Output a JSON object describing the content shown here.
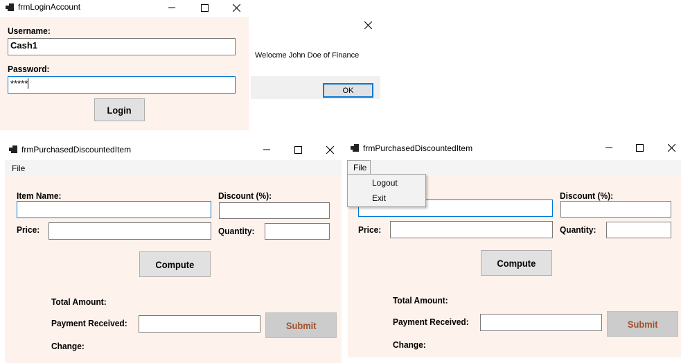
{
  "login": {
    "title": "frmLoginAccount",
    "username_label": "Username:",
    "username_value": "Cash1",
    "password_label": "Password:",
    "password_value": "*****",
    "login_button": "Login"
  },
  "msgbox": {
    "message": "Welocme John Doe of Finance",
    "ok_button": "OK"
  },
  "purchase_left": {
    "title": "frmPurchasedDiscountedItem",
    "menu_file": "File",
    "item_name_label": "Item Name:",
    "discount_label": "Discount (%):",
    "price_label": "Price:",
    "quantity_label": "Quantity:",
    "compute_button": "Compute",
    "total_amount_label": "Total Amount:",
    "payment_received_label": "Payment Received:",
    "submit_button": "Submit",
    "change_label": "Change:"
  },
  "purchase_right": {
    "title": "frmPurchasedDiscountedItem",
    "menu_file": "File",
    "menu_items": [
      "Logout",
      "Exit"
    ],
    "discount_label": "Discount (%):",
    "price_label": "Price:",
    "quantity_label": "Quantity:",
    "compute_button": "Compute",
    "total_amount_label": "Total Amount:",
    "payment_received_label": "Payment Received:",
    "submit_button": "Submit",
    "change_label": "Change:"
  },
  "colors": {
    "form_background": "#fdf2ec",
    "focus_border": "#0078d7",
    "disabled_button_text": "#a0522d"
  },
  "icons": [
    "app-icon",
    "minimize-icon",
    "maximize-icon",
    "close-icon"
  ]
}
